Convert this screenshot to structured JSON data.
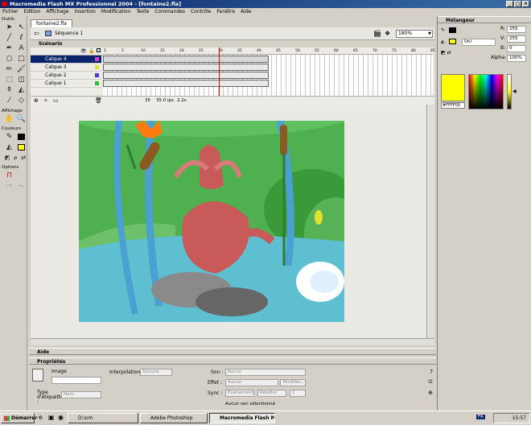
{
  "window": {
    "title": "Macromedia Flash MX Professionnel 2004 - [fontaine2.fla]",
    "buttons": [
      "_",
      "□",
      "×"
    ]
  },
  "menu": [
    "Fichier",
    "Edition",
    "Affichage",
    "Insertion",
    "Modification",
    "Texte",
    "Commandes",
    "Contrôle",
    "Fenêtre",
    "Aide"
  ],
  "tools": {
    "title": "Outils",
    "view_title": "Affichage",
    "colors_title": "Couleurs",
    "options_title": "Options"
  },
  "document": {
    "tab": "fontaine2.fla",
    "scene": "Séquence 1",
    "zoom": "180%"
  },
  "timeline": {
    "title": "Scénario",
    "layers": [
      "Calque 4",
      "Calque 3",
      "Calque 2",
      "Calque 1"
    ],
    "status": {
      "frame": "35",
      "fps": "35.0 ips",
      "time": "2.2s"
    },
    "ruler": [
      "1",
      "5",
      "10",
      "15",
      "20",
      "25",
      "30",
      "35",
      "40",
      "45",
      "50",
      "55",
      "60",
      "65",
      "70",
      "75",
      "80",
      "85"
    ]
  },
  "panels": {
    "aide": "Aide",
    "properties": "Propriétés"
  },
  "properties": {
    "image_label": "Image",
    "type_label": "Type d'étiquette :",
    "type_value": "Nom",
    "interpolation_label": "Interpolation :",
    "interpolation_value": "Aucune",
    "son_label": "Son :",
    "son_value": "Aucun",
    "effet_label": "Effet :",
    "effet_value": "Aucun",
    "modifier": "Modifier...",
    "sync_label": "Sync :",
    "sync_value": "Evénement",
    "repeat_value": "Répéter",
    "repeat_count": "1",
    "status": "Aucun son sélectionné"
  },
  "mixer": {
    "title": "Mélangeur",
    "type": "Uni",
    "r_label": "R:",
    "r": "255",
    "v_label": "V:",
    "v": "255",
    "b_label": "B:",
    "b": "0",
    "alpha_label": "Alpha:",
    "alpha": "100%",
    "hex": "#FFFF00",
    "fill_color": "#FFFF00"
  },
  "taskbar": {
    "start": "Démarrer",
    "items": [
      "D:\\nm",
      "Adobe Photoshop",
      "Macromedia Flash MX..."
    ],
    "lang": "FR",
    "clock": "15:57"
  }
}
